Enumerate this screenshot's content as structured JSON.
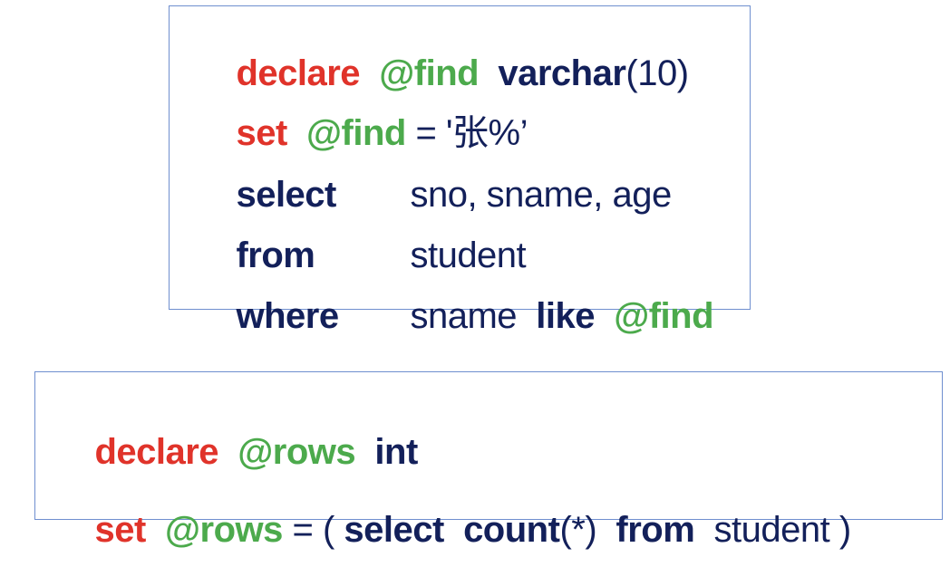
{
  "box1": {
    "line1": {
      "declare": "declare",
      "var": "@find",
      "type": "varchar",
      "size": "(10)"
    },
    "line2": {
      "set": "set",
      "var": "@find",
      "eq": "= ",
      "value": "'张%’"
    },
    "line3": {
      "kw": "select",
      "text": "sno, sname, age"
    },
    "line4": {
      "kw": "from",
      "text": "student"
    },
    "line5": {
      "kw": "where",
      "text": "sname",
      "like": "like",
      "var": "@find"
    }
  },
  "box2": {
    "line1": {
      "declare": "declare",
      "var": "@rows",
      "type": "int"
    },
    "line2": {
      "set": "set",
      "var": "@rows",
      "eq": "= ( ",
      "select": "select",
      "count": "count",
      "count_arg": "(*)",
      "from": "from",
      "table": "student",
      "close": " )"
    }
  },
  "colors": {
    "red": "#e0332a",
    "green": "#4caa4c",
    "navy": "#13205a",
    "border": "#6f8fcf"
  }
}
